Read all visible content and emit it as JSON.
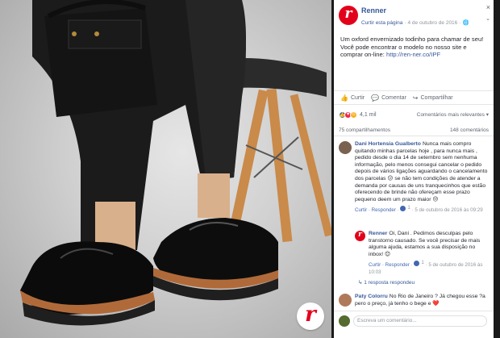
{
  "post": {
    "page_name": "Renner",
    "follow_label": "Curtir esta página",
    "date": "4 de outubro de 2016",
    "globe": "🌐",
    "close_glyph": "×",
    "caret_glyph": "⌄",
    "text_1": "Um oxford envernizado todinho para chamar de seu! Você pode encontrar o modelo no nosso site e comprar on-line: ",
    "link": "http://ren-ner.co/IPF",
    "logo_letter": "r"
  },
  "actions": {
    "like": "Curtir",
    "comment": "Comentar",
    "share": "Compartilhar"
  },
  "reactions": {
    "count": "4,1 mil",
    "sort_label": "Comentários mais relevantes ▾"
  },
  "counts": {
    "shares": "75 compartilhamentos",
    "comments": "148 comentários"
  },
  "comments": [
    {
      "name": "Dani Hortensia Gualberto",
      "text": "Nunca mais compro quitando minhas parcelas hoje , para nunca mais , pedido desde o dia 14 de setembro sem nenhuma informação, pelo menos consegui cancelar o pedido depois de vários ligações aguardando o cancelamento dos parcelas 😕 se não tem condições de atender a demanda por causas de uns tranquecinhos que estão oferecendo de brinde não ofereçam esse prazo pequeno deem um prazo maior 😒",
      "reply": "Curtir · Responder",
      "likes": "1",
      "date": "5 de outubro de 2016 às 09:29"
    },
    {
      "name": "Renner",
      "text": "Oi, Dani . Pedimos desculpas pelo transtorno causado. Se você precisar de mais alguma ajuda, estamos a sua disposição no inbox! 😊",
      "reply": "Curtir · Responder",
      "likes": "1",
      "date": "5 de outubro de 2016 às 10:03"
    },
    {
      "name": "Paty Colorru",
      "text": "No Rio de Janeiro ? Já chegou esse ?a pero o preço, já tenho o bege e ❤️",
      "reply": "",
      "likes": "",
      "date": ""
    }
  ],
  "more_replies": "1 resposta respondeu",
  "reply_placeholder": "Escreva um comentário...",
  "colors": {
    "brand_red": "#e3001b",
    "fb_blue": "#365899"
  }
}
